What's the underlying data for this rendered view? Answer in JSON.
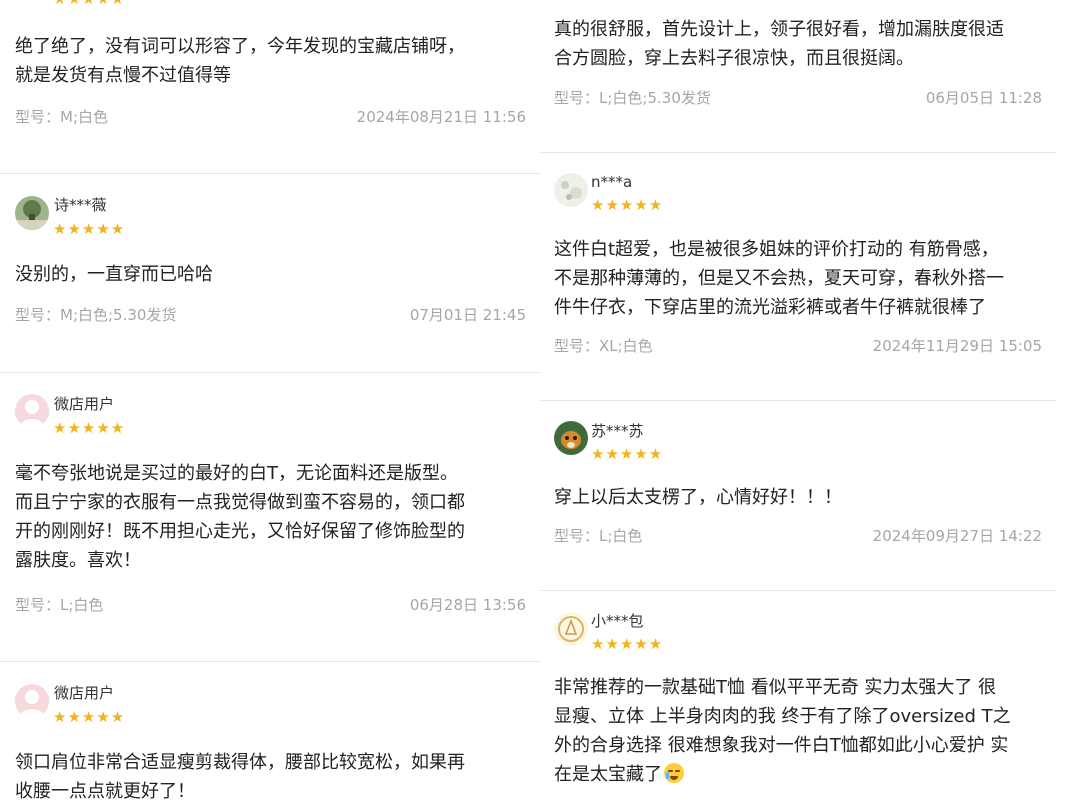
{
  "colors": {
    "star": "#f3b31c",
    "meta": "#a6a6a6",
    "divider": "#e6e6e6"
  },
  "star_glyphs": "★★★★★",
  "left": {
    "r1": {
      "text1": "绝了绝了，没有词可以形容了，今年发现的宝藏店铺呀，",
      "text2": "就是发货有点慢不过值得等",
      "meta": "型号：M;白色",
      "date": "2024年08月21日 11:56"
    },
    "r2": {
      "user": "诗***薇",
      "text1": "没别的，一直穿而已哈哈",
      "meta": "型号：M;白色;5.30发货",
      "date": "07月01日 21:45"
    },
    "r3": {
      "user": "微店用户",
      "text1": "毫不夸张地说是买过的最好的白T，无论面料还是版型。",
      "text2": "而且宁宁家的衣服有一点我觉得做到蛮不容易的，领口都",
      "text3": "开的刚刚好！既不用担心走光，又恰好保留了修饰脸型的",
      "text4": "露肤度。喜欢！",
      "meta": "型号：L;白色",
      "date": "06月28日 13:56"
    },
    "r4": {
      "user": "微店用户",
      "text1": "领口肩位非常合适显瘦剪裁得体，腰部比较宽松，如果再",
      "text2": "收腰一点点就更好了！"
    }
  },
  "right": {
    "r1": {
      "text1": "真的很舒服，首先设计上，领子很好看，增加漏肤度很适",
      "text2": "合方圆脸，穿上去料子很凉快，而且很挺阔。",
      "meta": "型号：L;白色;5.30发货",
      "date": "06月05日 11:28"
    },
    "r2": {
      "user": "n***a",
      "text1": "这件白t超爱，也是被很多姐妹的评价打动的 有筋骨感，",
      "text2": "不是那种薄薄的，但是又不会热，夏天可穿，春秋外搭一",
      "text3": "件牛仔衣，下穿店里的流光溢彩裤或者牛仔裤就很棒了",
      "meta": "型号：XL;白色",
      "date": "2024年11月29日 15:05"
    },
    "r3": {
      "user": "苏***苏",
      "text1": "穿上以后太支楞了，心情好好！！！",
      "meta": "型号：L;白色",
      "date": "2024年09月27日 14:22"
    },
    "r4": {
      "user": "小***包",
      "text1": "非常推荐的一款基础T恤 看似平平无奇 实力太强大了 很",
      "text2": "显瘦、立体 上半身肉肉的我 终于有了除了oversized T之",
      "text3": "外的合身选择 很难想象我对一件白T恤都如此小心爱护 实",
      "text4": "在是太宝藏了",
      "emoji": "crying-face-emoji"
    }
  }
}
